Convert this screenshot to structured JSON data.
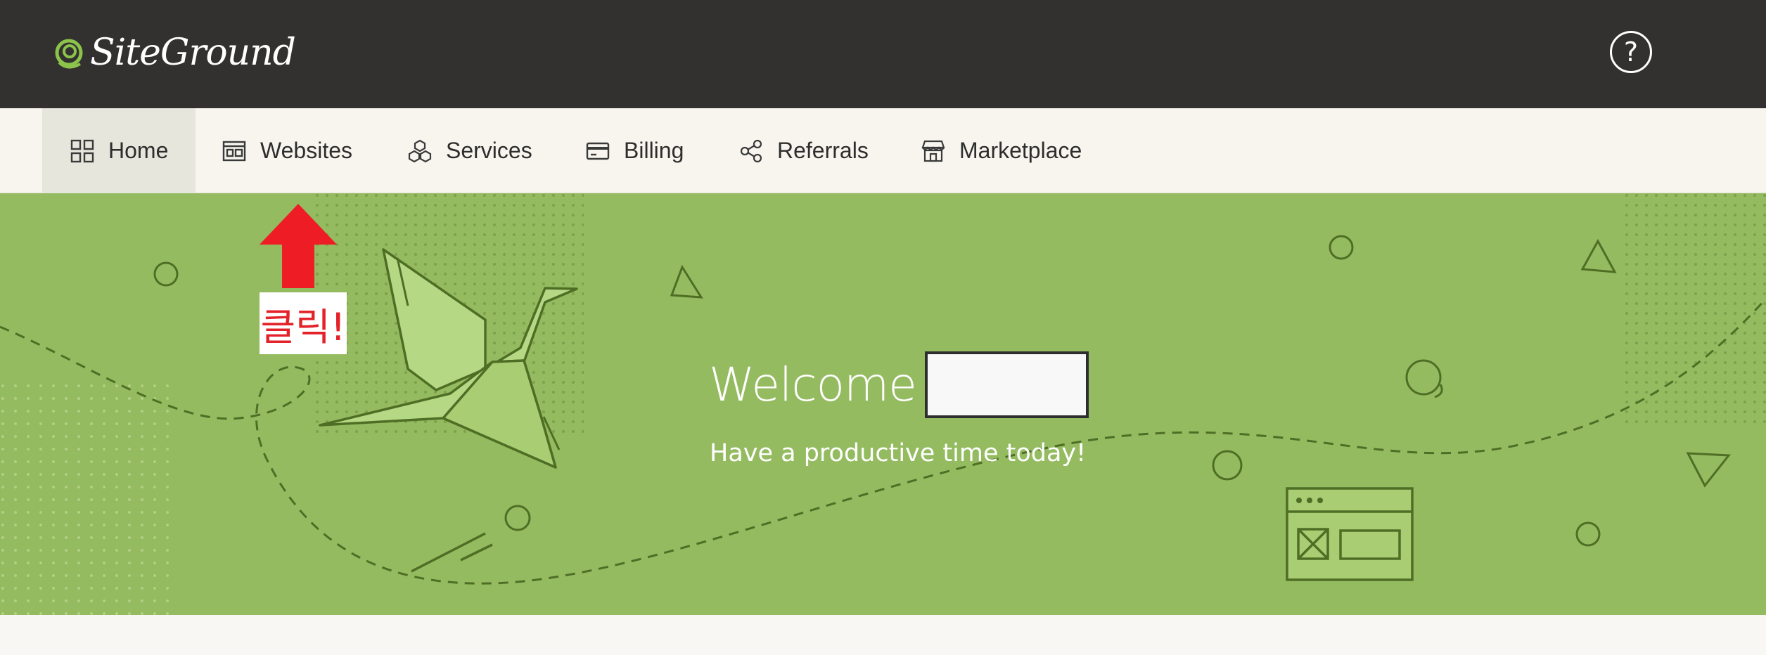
{
  "header": {
    "logo_text": "SiteGround",
    "help_label": "?"
  },
  "nav": {
    "items": [
      {
        "label": "Home",
        "icon": "grid-icon",
        "active": true
      },
      {
        "label": "Websites",
        "icon": "browser-window-icon",
        "active": false
      },
      {
        "label": "Services",
        "icon": "cubes-icon",
        "active": false
      },
      {
        "label": "Billing",
        "icon": "credit-card-icon",
        "active": false
      },
      {
        "label": "Referrals",
        "icon": "share-nodes-icon",
        "active": false
      },
      {
        "label": "Marketplace",
        "icon": "storefront-icon",
        "active": false
      }
    ]
  },
  "hero": {
    "welcome": "Welcome",
    "subtitle": "Have a productive time today!"
  },
  "annotation": {
    "label": "클릭!",
    "color": "#e32229"
  },
  "colors": {
    "header_bg": "#323130",
    "nav_bg": "#f7f5ee",
    "hero_bg": "#94bb60",
    "accent_green": "#8cc34a"
  }
}
